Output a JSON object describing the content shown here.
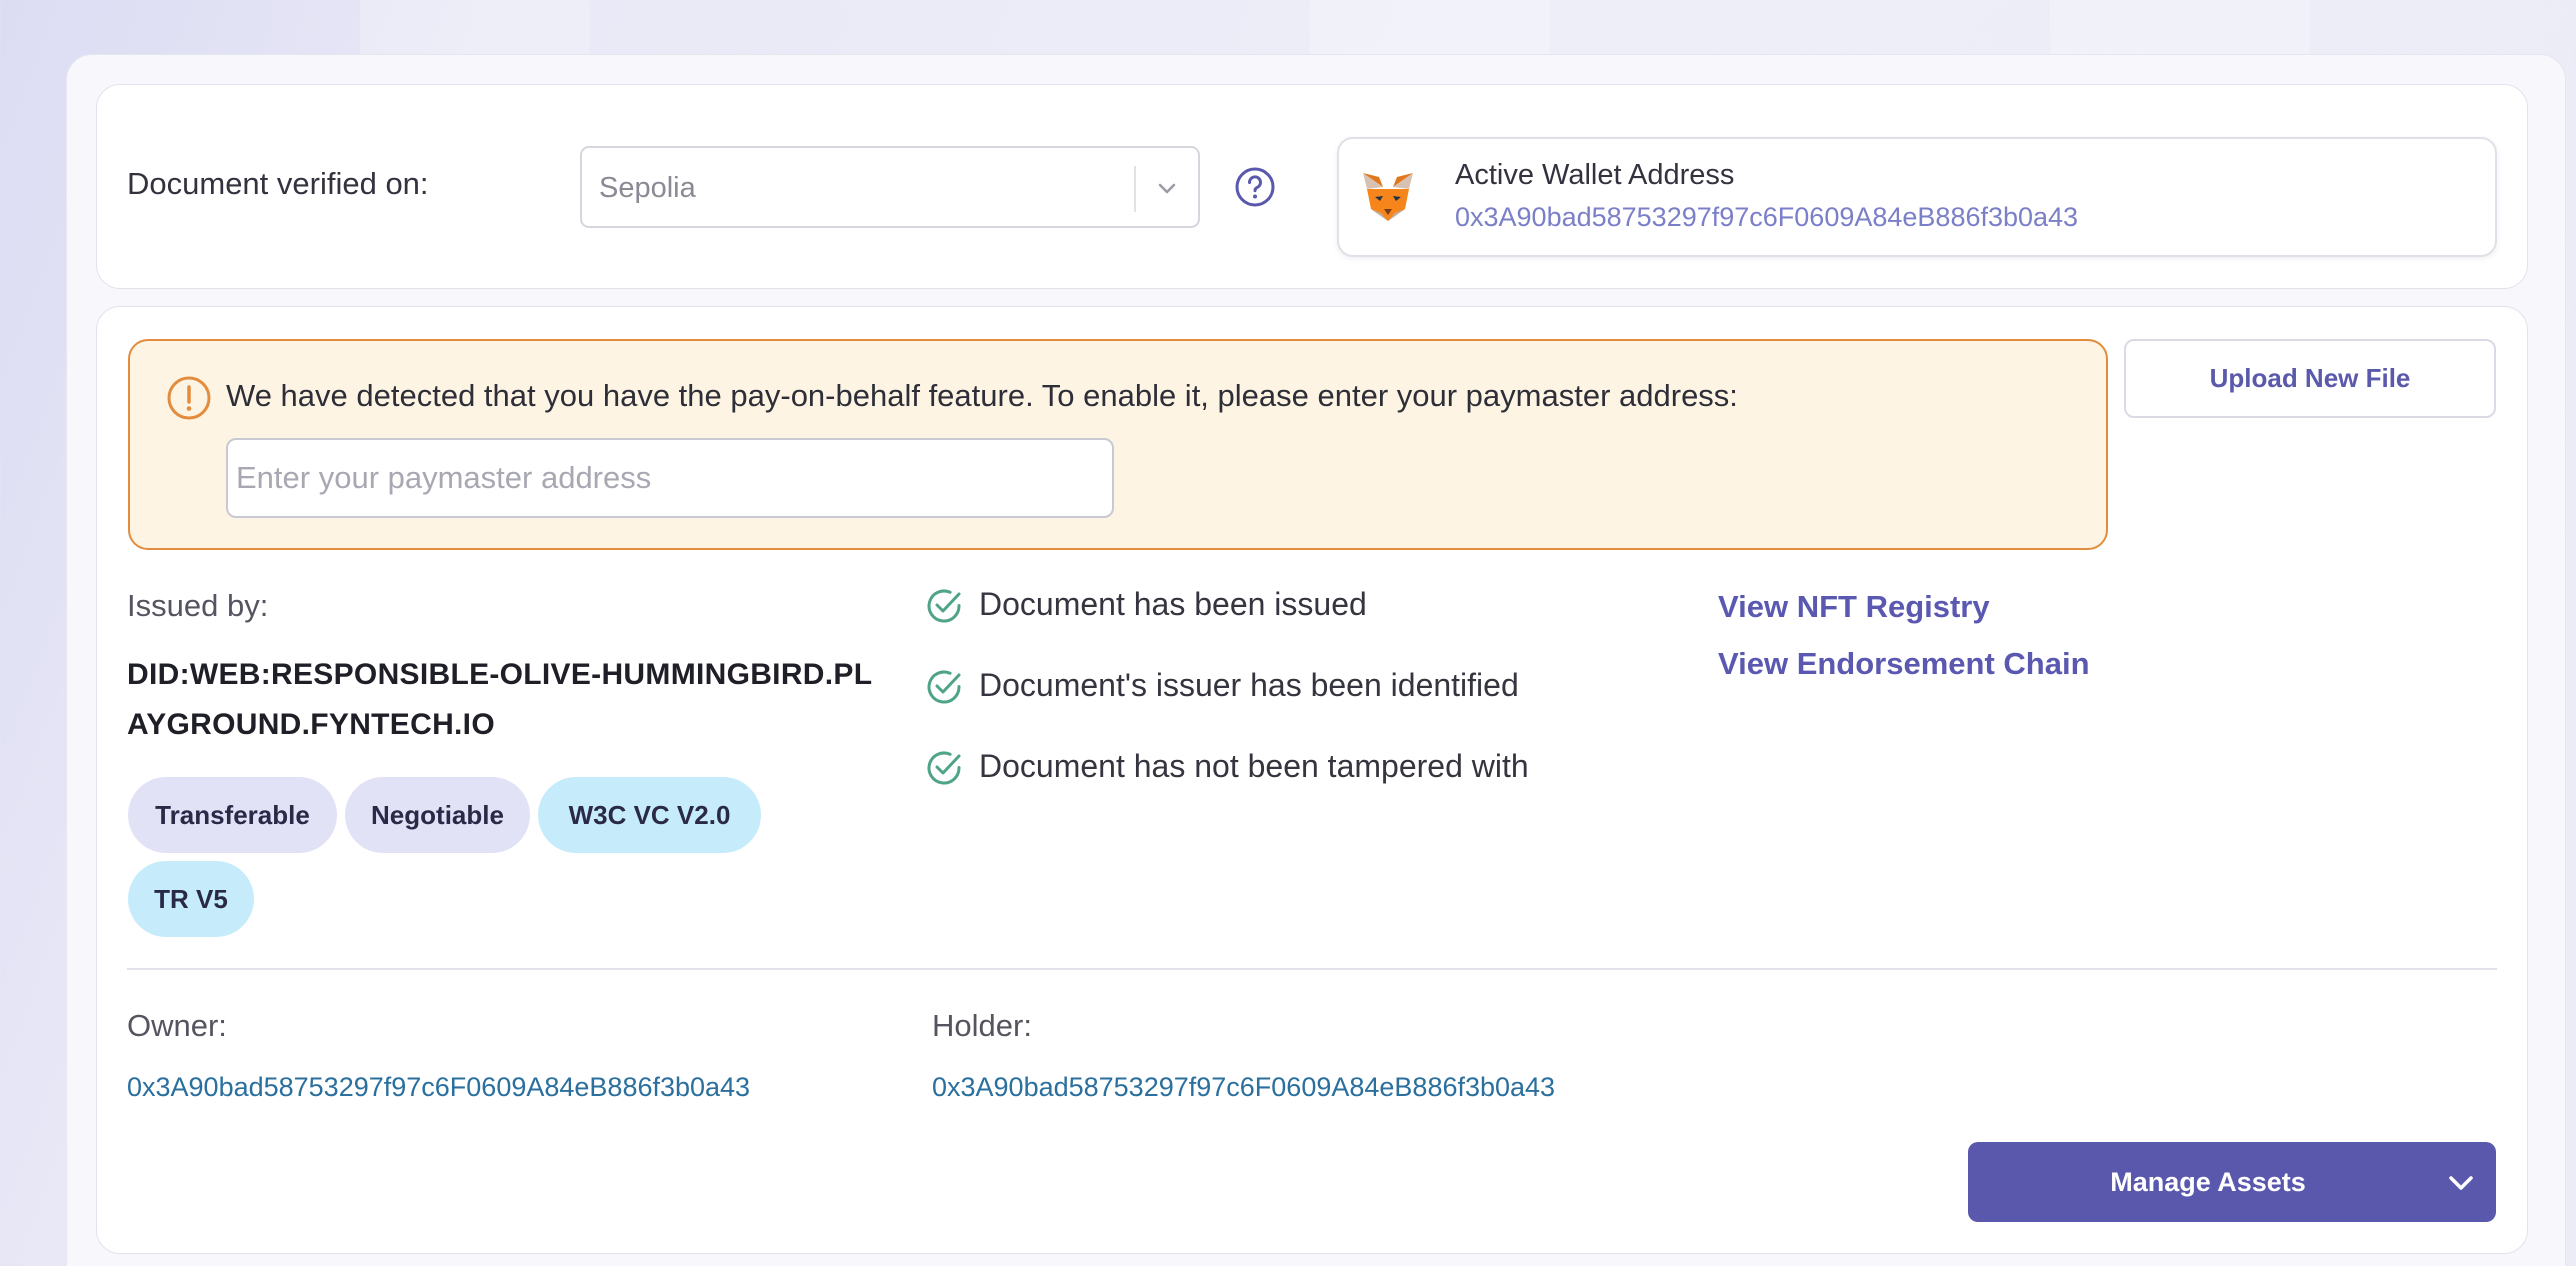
{
  "network": {
    "label": "Document verified on:",
    "selected": "Sepolia"
  },
  "wallet": {
    "title": "Active Wallet Address",
    "address": "0x3A90bad58753297f97c6F0609A84eB886f3b0a43"
  },
  "paymaster": {
    "message": "We have detected that you have the pay-on-behalf feature. To enable it, please enter your paymaster address:",
    "placeholder": "Enter your paymaster address",
    "value": ""
  },
  "upload_label": "Upload New File",
  "issuer": {
    "label": "Issued by:",
    "name": "DID:WEB:RESPONSIBLE-OLIVE-HUMMINGBIRD.PLAYGROUND.FYNTECH.IO"
  },
  "tags": [
    "Transferable",
    "Negotiable",
    "W3C VC V2.0",
    "TR V5"
  ],
  "checks": [
    "Document has been issued",
    "Document's issuer has been identified",
    "Document has not been tampered with"
  ],
  "links": {
    "nft_registry": "View NFT Registry",
    "endorsement_chain": "View Endorsement Chain"
  },
  "owner": {
    "label": "Owner:",
    "address": "0x3A90bad58753297f97c6F0609A84eB886f3b0a43"
  },
  "holder": {
    "label": "Holder:",
    "address": "0x3A90bad58753297f97c6F0609A84eB886f3b0a43"
  },
  "manage_label": "Manage Assets",
  "colors": {
    "accent": "#5a58ad",
    "warning_border": "#e48c3d",
    "warning_bg": "#fdf4e3",
    "check_green": "#4fa387",
    "address_link": "#2a6f9e"
  },
  "icons": {
    "network_dropdown": "chevron-down-icon",
    "help": "question-circle-icon",
    "wallet": "metamask-fox-icon",
    "warning": "exclamation-circle-icon",
    "check": "check-circle-icon",
    "manage_dropdown": "chevron-down-icon"
  }
}
